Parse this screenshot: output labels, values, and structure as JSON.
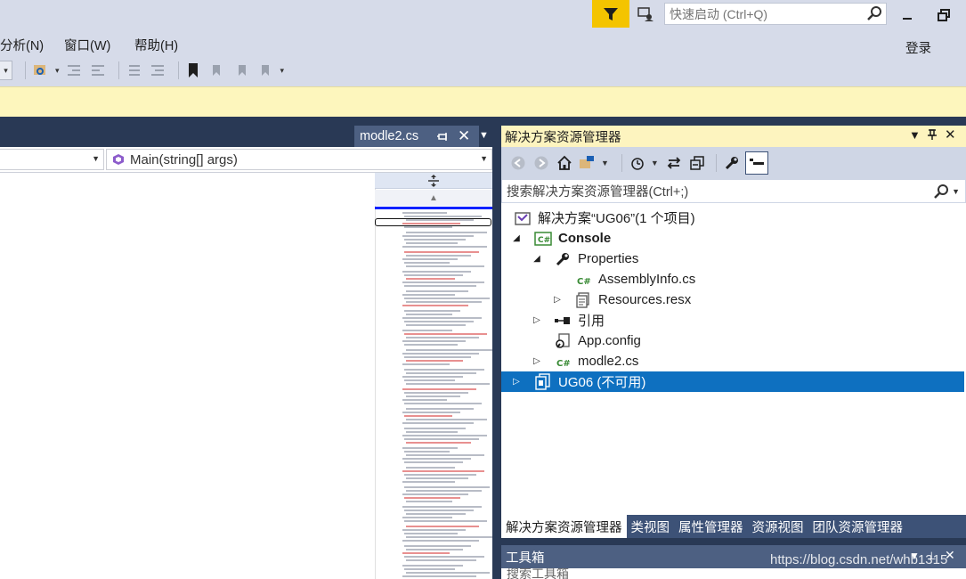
{
  "titlebar": {
    "quick_launch_placeholder": "快速启动 (Ctrl+Q)",
    "signin": "登录"
  },
  "menu": [
    {
      "label": "分析(N)"
    },
    {
      "label": "窗口(W)"
    },
    {
      "label": "帮助(H)"
    }
  ],
  "editor": {
    "tab_title": "modle2.cs",
    "member_nav": "Main(string[] args)"
  },
  "solution_explorer": {
    "title": "解决方案资源管理器",
    "search_placeholder": "搜索解决方案资源管理器(Ctrl+;)",
    "tree": [
      {
        "label": "解决方案“UG06”(1 个项目)",
        "icon": "solution-icon"
      },
      {
        "label": "Console",
        "icon": "csharp-project-icon",
        "expanded": true,
        "bold": true
      },
      {
        "label": "Properties",
        "icon": "wrench-icon",
        "expanded": true
      },
      {
        "label": "AssemblyInfo.cs",
        "icon": "csharp-file-icon"
      },
      {
        "label": "Resources.resx",
        "icon": "resx-file-icon",
        "expanded": false
      },
      {
        "label": "引用",
        "icon": "references-icon",
        "expanded": false
      },
      {
        "label": "App.config",
        "icon": "config-icon"
      },
      {
        "label": "modle2.cs",
        "icon": "csharp-file-icon",
        "expanded": false
      },
      {
        "label": "UG06 (不可用)",
        "icon": "unavailable-project-icon",
        "expanded": false,
        "selected": true
      }
    ]
  },
  "bottom_tabs": [
    {
      "label": "解决方案资源管理器",
      "active": true
    },
    {
      "label": "类视图"
    },
    {
      "label": "属性管理器"
    },
    {
      "label": "资源视图"
    },
    {
      "label": "团队资源管理器"
    }
  ],
  "toolbox": {
    "title": "工具箱",
    "search_placeholder": "搜索工具箱"
  },
  "watermark": "https://blog.csdn.net/whb1315",
  "colors": {
    "selection": "#0e70c0",
    "title_active": "#fdf4bf",
    "chrome_dark": "#293955",
    "notification": "#f4c400"
  }
}
